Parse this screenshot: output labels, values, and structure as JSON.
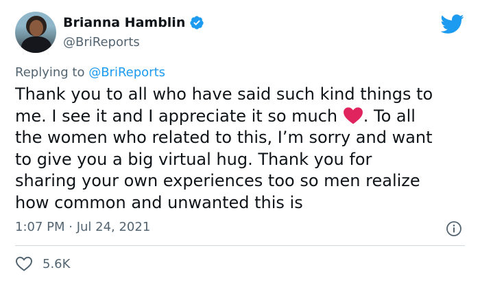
{
  "author": {
    "display_name": "Brianna Hamblin",
    "handle": "@BriReports"
  },
  "reply_to": {
    "prefix": "Replying to ",
    "mention": "@BriReports"
  },
  "tweet": {
    "text_part1": "Thank you to all who have said such kind things to\nme. I see it and I appreciate it so much ",
    "emoji": "red-heart-emoji",
    "text_part2": ". To all\nthe women who related to this, I’m sorry and want\nto give you a big virtual hug. Thank you for\nsharing your own experiences too so men realize\nhow common and unwanted this is"
  },
  "meta": {
    "timestamp": "1:07 PM · Jul 24, 2021"
  },
  "actions": {
    "like_count": "5.6K"
  },
  "colors": {
    "accent": "#1d9bf0",
    "secondary_text": "#536471",
    "divider": "#cfd9de",
    "heart": "#e0245e"
  }
}
